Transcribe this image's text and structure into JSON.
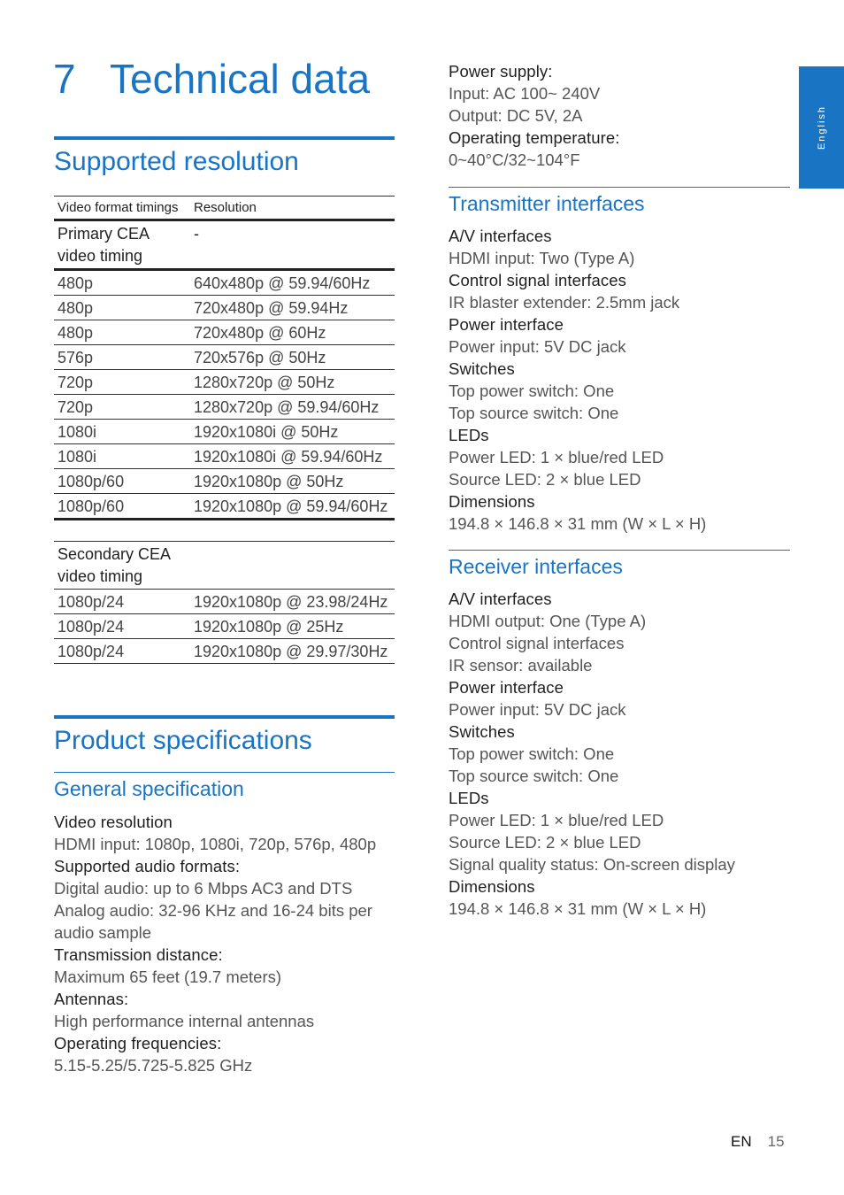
{
  "chapter": {
    "number": "7",
    "title": "Technical data"
  },
  "side_tab": {
    "label": "English"
  },
  "supported_resolution": {
    "heading": "Supported resolution",
    "table": {
      "headers": [
        "Video format timings",
        "Resolution"
      ],
      "primary": {
        "label": "Primary CEA video timing",
        "value": "-",
        "rows": [
          [
            "480p",
            "640x480p @ 59.94/60Hz"
          ],
          [
            "480p",
            "720x480p @ 59.94Hz"
          ],
          [
            "480p",
            "720x480p @ 60Hz"
          ],
          [
            "576p",
            "720x576p @ 50Hz"
          ],
          [
            "720p",
            "1280x720p @ 50Hz"
          ],
          [
            "720p",
            "1280x720p @ 59.94/60Hz"
          ],
          [
            "1080i",
            "1920x1080i @ 50Hz"
          ],
          [
            "1080i",
            "1920x1080i @ 59.94/60Hz"
          ],
          [
            "1080p/60",
            "1920x1080p @ 50Hz"
          ],
          [
            "1080p/60",
            "1920x1080p @ 59.94/60Hz"
          ]
        ]
      },
      "secondary": {
        "label": "Secondary CEA video timing",
        "value": "",
        "rows": [
          [
            "1080p/24",
            "1920x1080p @ 23.98/24Hz"
          ],
          [
            "1080p/24",
            "1920x1080p @ 25Hz"
          ],
          [
            "1080p/24",
            "1920x1080p @ 29.97/30Hz"
          ]
        ]
      }
    }
  },
  "product_specifications": {
    "heading": "Product specifications",
    "general": {
      "heading": "General specification",
      "lines": [
        {
          "text": "Video resolution",
          "type": "label"
        },
        {
          "text": "HDMI input: 1080p, 1080i, 720p, 576p, 480p",
          "type": "value"
        },
        {
          "text": "Supported audio formats:",
          "type": "label"
        },
        {
          "text": "Digital audio: up to 6 Mbps AC3 and DTS",
          "type": "value"
        },
        {
          "text": "Analog audio: 32-96 KHz and 16-24 bits per audio sample",
          "type": "value"
        },
        {
          "text": "Transmission distance:",
          "type": "label"
        },
        {
          "text": "Maximum 65 feet (19.7 meters)",
          "type": "value"
        },
        {
          "text": "Antennas:",
          "type": "label"
        },
        {
          "text": "High performance internal antennas",
          "type": "value"
        },
        {
          "text": "Operating frequencies:",
          "type": "label"
        },
        {
          "text": "5.15-5.25/5.725-5.825 GHz",
          "type": "value"
        }
      ]
    },
    "power": {
      "lines": [
        {
          "text": "Power supply:",
          "type": "label"
        },
        {
          "text": "Input: AC 100~ 240V",
          "type": "value"
        },
        {
          "text": "Output: DC 5V, 2A",
          "type": "value"
        },
        {
          "text": "Operating temperature:",
          "type": "label"
        },
        {
          "text": "0~40°C/32~104°F",
          "type": "value"
        }
      ]
    },
    "transmitter": {
      "heading": "Transmitter interfaces",
      "lines": [
        {
          "text": "A/V interfaces",
          "type": "label"
        },
        {
          "text": "HDMI input: Two (Type A)",
          "type": "value"
        },
        {
          "text": "Control signal interfaces",
          "type": "label"
        },
        {
          "text": "IR blaster extender: 2.5mm jack",
          "type": "value"
        },
        {
          "text": "Power interface",
          "type": "label"
        },
        {
          "text": "Power input: 5V DC jack",
          "type": "value"
        },
        {
          "text": "Switches",
          "type": "label"
        },
        {
          "text": "Top power switch: One",
          "type": "value"
        },
        {
          "text": "Top source switch: One",
          "type": "value"
        },
        {
          "text": "LEDs",
          "type": "label"
        },
        {
          "text": "Power LED: 1 × blue/red LED",
          "type": "value"
        },
        {
          "text": "Source LED: 2 × blue LED",
          "type": "value"
        },
        {
          "text": "Dimensions",
          "type": "label"
        },
        {
          "text": "194.8 × 146.8 × 31 mm (W × L × H)",
          "type": "value"
        }
      ]
    },
    "receiver": {
      "heading": "Receiver interfaces",
      "lines": [
        {
          "text": "A/V interfaces",
          "type": "label"
        },
        {
          "text": "HDMI output: One (Type A)",
          "type": "value"
        },
        {
          "text": "Control signal interfaces",
          "type": "value"
        },
        {
          "text": "IR sensor: available",
          "type": "value"
        },
        {
          "text": "Power interface",
          "type": "label"
        },
        {
          "text": "Power input: 5V DC jack",
          "type": "value"
        },
        {
          "text": "Switches",
          "type": "label"
        },
        {
          "text": "Top power switch: One",
          "type": "value"
        },
        {
          "text": "Top source switch: One",
          "type": "value"
        },
        {
          "text": "LEDs",
          "type": "label"
        },
        {
          "text": "Power LED: 1 × blue/red LED",
          "type": "value"
        },
        {
          "text": "Source LED: 2 × blue LED",
          "type": "value"
        },
        {
          "text": "Signal quality status: On-screen display",
          "type": "value"
        },
        {
          "text": "Dimensions",
          "type": "label"
        },
        {
          "text": "194.8 × 146.8 × 31 mm (W × L × H)",
          "type": "value"
        }
      ]
    }
  },
  "footer": {
    "language": "EN",
    "page_number": "15"
  },
  "colors": {
    "accent": "#1a74c4",
    "text": "#1a1a1a",
    "muted": "#555555"
  }
}
